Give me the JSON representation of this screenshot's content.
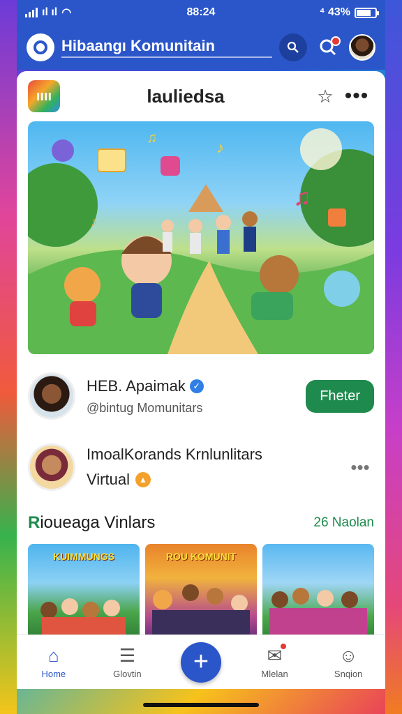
{
  "status_bar": {
    "signal_text": "ıl ıl",
    "time": "88:24",
    "battery_text": "⁴ 43%"
  },
  "header": {
    "title": "Hibaangı Komunitain"
  },
  "card": {
    "title": "lauliedsa",
    "icon_text": "ıııı"
  },
  "profile": {
    "name": "HEB. Apaimak",
    "handle": "@bintug Momunitars",
    "follow_label": "Fheter"
  },
  "community": {
    "name": "ImoalKorands Krnlunlitars",
    "subtitle": "Virtual"
  },
  "section": {
    "title_first": "R",
    "title_rest": "ioueaga Vinlars",
    "link": "26 Naolan"
  },
  "thumbnails": [
    {
      "label": "KUIMMUNGS"
    },
    {
      "label": "ROU KOMUNIT"
    },
    {
      "label": ""
    }
  ],
  "nav": [
    {
      "label": "Home"
    },
    {
      "label": "Glovtin"
    },
    {
      "label": ""
    },
    {
      "label": "Mlelan"
    },
    {
      "label": "Snqion"
    }
  ],
  "colors": {
    "brand_blue": "#2b56c9",
    "accent_green": "#1e8a4d",
    "badge_red": "#e53935"
  },
  "icons": [
    "wifi-icon",
    "search-icon",
    "bell-icon",
    "star-icon",
    "more-icon",
    "verified-icon",
    "home-icon",
    "document-icon",
    "plus-icon",
    "message-icon",
    "profile-icon"
  ]
}
